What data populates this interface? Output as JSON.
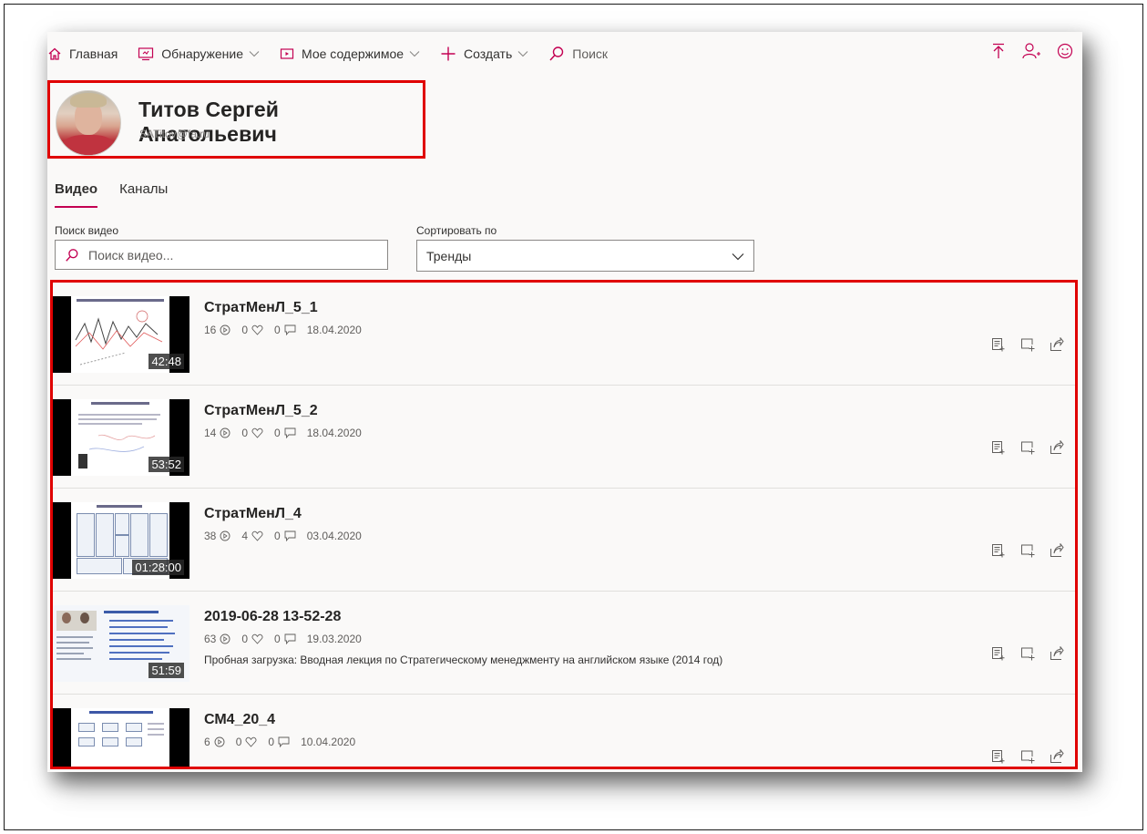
{
  "nav": {
    "home_label": "Главная",
    "discover_label": "Обнаружение",
    "mycontent_label": "Мое содержимое",
    "create_label": "Создать",
    "search_label": "Поиск"
  },
  "profile": {
    "name": "Титов Сергей Анатольевич",
    "email": "SATitov@fa.ru"
  },
  "tabs": [
    {
      "label": "Видео",
      "active": true
    },
    {
      "label": "Каналы",
      "active": false
    }
  ],
  "search": {
    "label": "Поиск видео",
    "placeholder": "Поиск видео..."
  },
  "sort": {
    "label": "Сортировать по",
    "value": "Тренды"
  },
  "videos": [
    {
      "title": "СтратМенЛ_5_1",
      "views": "16",
      "likes": "0",
      "comments": "0",
      "date": "18.04.2020",
      "duration": "42:48",
      "description": ""
    },
    {
      "title": "СтратМенЛ_5_2",
      "views": "14",
      "likes": "0",
      "comments": "0",
      "date": "18.04.2020",
      "duration": "53:52",
      "description": ""
    },
    {
      "title": "СтратМенЛ_4",
      "views": "38",
      "likes": "4",
      "comments": "0",
      "date": "03.04.2020",
      "duration": "01:28:00",
      "description": ""
    },
    {
      "title": "2019-06-28 13-52-28",
      "views": "63",
      "likes": "0",
      "comments": "0",
      "date": "19.03.2020",
      "duration": "51:59",
      "description": "Пробная загрузка: Вводная лекция по Стратегическому менеджменту на английском языке (2014 год)"
    },
    {
      "title": "СМ4_20_4",
      "views": "6",
      "likes": "0",
      "comments": "0",
      "date": "10.04.2020",
      "duration": "",
      "description": ""
    }
  ],
  "colors": {
    "accent": "#c30052",
    "highlight": "#e00000"
  }
}
